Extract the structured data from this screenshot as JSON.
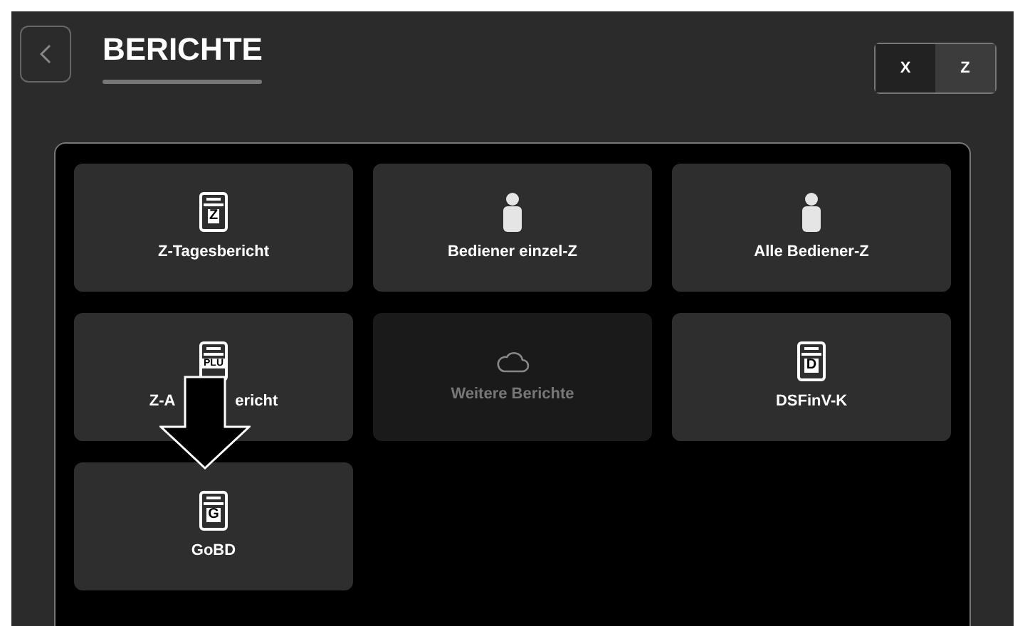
{
  "header": {
    "title": "BERICHTE",
    "toggle": [
      {
        "label": "X",
        "selected": true
      },
      {
        "label": "Z",
        "selected": false
      }
    ]
  },
  "tiles": [
    {
      "kind": "report",
      "icon_text": "Z",
      "label": "Z-Tagesbericht",
      "disabled": false
    },
    {
      "kind": "person",
      "label": "Bediener einzel-Z",
      "disabled": false
    },
    {
      "kind": "person",
      "label": "Alle Bediener-Z",
      "disabled": false
    },
    {
      "kind": "report",
      "icon_text": "PLU",
      "label_parts": [
        "Z-A",
        "ericht"
      ],
      "disabled": false
    },
    {
      "kind": "cloud",
      "label": "Weitere Berichte",
      "disabled": true
    },
    {
      "kind": "report",
      "icon_text": "D",
      "label": "DSFinV-K",
      "disabled": false
    },
    {
      "kind": "report",
      "icon_text": "G",
      "label": "GoBD",
      "disabled": false
    }
  ]
}
